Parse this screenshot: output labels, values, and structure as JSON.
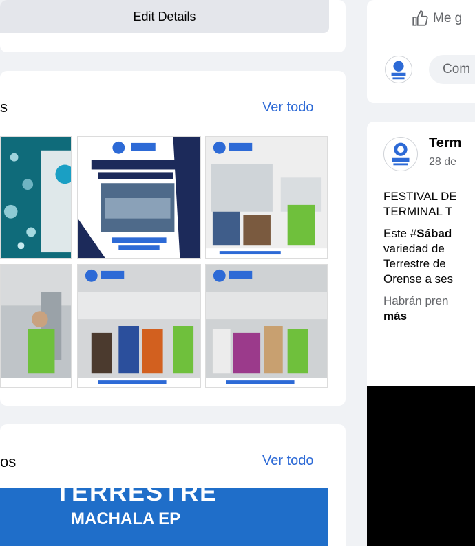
{
  "intro": {
    "edit_details_label": "Edit Details"
  },
  "photos": {
    "title_fragment": "s",
    "see_all": "Ver todo"
  },
  "videos": {
    "title_fragment": "os",
    "see_all": "Ver todo",
    "thumb_line1": "TERRESTRE",
    "thumb_line2": "MACHALA EP"
  },
  "post_top": {
    "like_label": "Me g",
    "comment_placeholder": "Com"
  },
  "post": {
    "author": "Term",
    "date": "28 de",
    "title_line1": "FESTIVAL DE",
    "title_line2": "TERMINAL T",
    "body_prefix": "Este #",
    "body_bold": "Sábad",
    "body_line2": "variedad de",
    "body_line3": "Terrestre de",
    "body_line4": "Orense a ses",
    "body_line5": "Habrán pren",
    "more": "más"
  },
  "colors": {
    "link": "#2d6ad6",
    "navy": "#1c2a5a",
    "vest": "#4caf50",
    "bg": "#f0f2f5"
  },
  "icons": [
    "like-icon",
    "page-avatar-icon"
  ]
}
